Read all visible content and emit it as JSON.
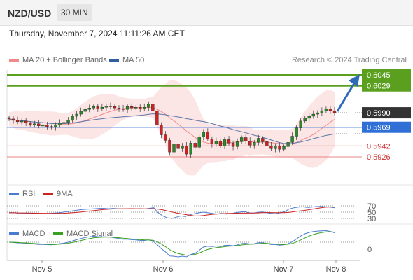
{
  "header": {
    "symbol": "NZD/USD",
    "interval": "30 MIN"
  },
  "timestamp": "Thursday, November 7, 2024 11:11:26 AM CET",
  "legend": {
    "bollinger": {
      "label": "MA 20 + Bollinger Bands",
      "color": "#f08a8a"
    },
    "ma50": {
      "label": "MA 50",
      "color": "#2f5f9e"
    },
    "credit": "Research © 2024 Trading Central"
  },
  "rsi_legend": {
    "rsi": "RSI",
    "ma": "9MA"
  },
  "macd_legend": {
    "macd": "MACD",
    "signal": "MACD Signal"
  },
  "colors": {
    "bull": "#2a8a2a",
    "bear": "#cc2222",
    "target": "#5aa01e",
    "current": "#333333",
    "pivot": "#2f6fd6",
    "support": "#e06060",
    "arrow": "#2f6ab8"
  },
  "chart_data": {
    "type": "candlestick",
    "x_labels": [
      "Nov 5",
      "Nov 6",
      "Nov 7",
      "Nov 8"
    ],
    "y_range": [
      0.5914,
      0.6052
    ],
    "levels": [
      {
        "value": 0.6045,
        "label": "0.6045",
        "kind": "target"
      },
      {
        "value": 0.6029,
        "label": "0.6029",
        "kind": "target"
      },
      {
        "value": 0.599,
        "label": "0.5990",
        "kind": "current"
      },
      {
        "value": 0.5969,
        "label": "0.5969",
        "kind": "pivot"
      },
      {
        "value": 0.5942,
        "label": "0.5942",
        "kind": "support"
      },
      {
        "value": 0.5926,
        "label": "0.5926",
        "kind": "support"
      }
    ],
    "close": [
      0.5981,
      0.5979,
      0.5977,
      0.5978,
      0.5975,
      0.5973,
      0.5974,
      0.5971,
      0.5972,
      0.597,
      0.5969,
      0.5972,
      0.5975,
      0.5976,
      0.5979,
      0.5985,
      0.5988,
      0.5992,
      0.5995,
      0.5997,
      0.5999,
      0.5996,
      0.5998,
      0.6,
      0.5999,
      0.5997,
      0.5996,
      0.5995,
      0.5999,
      0.5997,
      0.5998,
      0.5996,
      0.5998,
      0.6003,
      0.5993,
      0.5972,
      0.5958,
      0.595,
      0.5933,
      0.5945,
      0.5938,
      0.5942,
      0.593,
      0.5946,
      0.594,
      0.5955,
      0.5962,
      0.5952,
      0.5945,
      0.5949,
      0.5942,
      0.5951,
      0.5946,
      0.5941,
      0.5948,
      0.5954,
      0.5949,
      0.5943,
      0.5947,
      0.5953,
      0.5948,
      0.5942,
      0.5938,
      0.5942,
      0.5937,
      0.5941,
      0.5947,
      0.5956,
      0.5968,
      0.5978,
      0.5982,
      0.5985,
      0.5988,
      0.599,
      0.5993,
      0.5996,
      0.5993,
      0.599
    ],
    "rsi": [
      48,
      48,
      47,
      47,
      46,
      46,
      45,
      45,
      45,
      46,
      47,
      48,
      50,
      52,
      54,
      56,
      58,
      59,
      60,
      61,
      62,
      62,
      61,
      62,
      61,
      60,
      60,
      61,
      60,
      61,
      60,
      62,
      64,
      48,
      38,
      32,
      30,
      34,
      38,
      36,
      42,
      45,
      48,
      50,
      48,
      46,
      44,
      46,
      44,
      45,
      48,
      50,
      52,
      48,
      47,
      49,
      51,
      48,
      46,
      45,
      48,
      52,
      60,
      64,
      66,
      67,
      65,
      66,
      68,
      68,
      67,
      66,
      64
    ],
    "rsi_ticks": [
      70,
      50,
      30
    ],
    "macd_zero_label": "0"
  }
}
